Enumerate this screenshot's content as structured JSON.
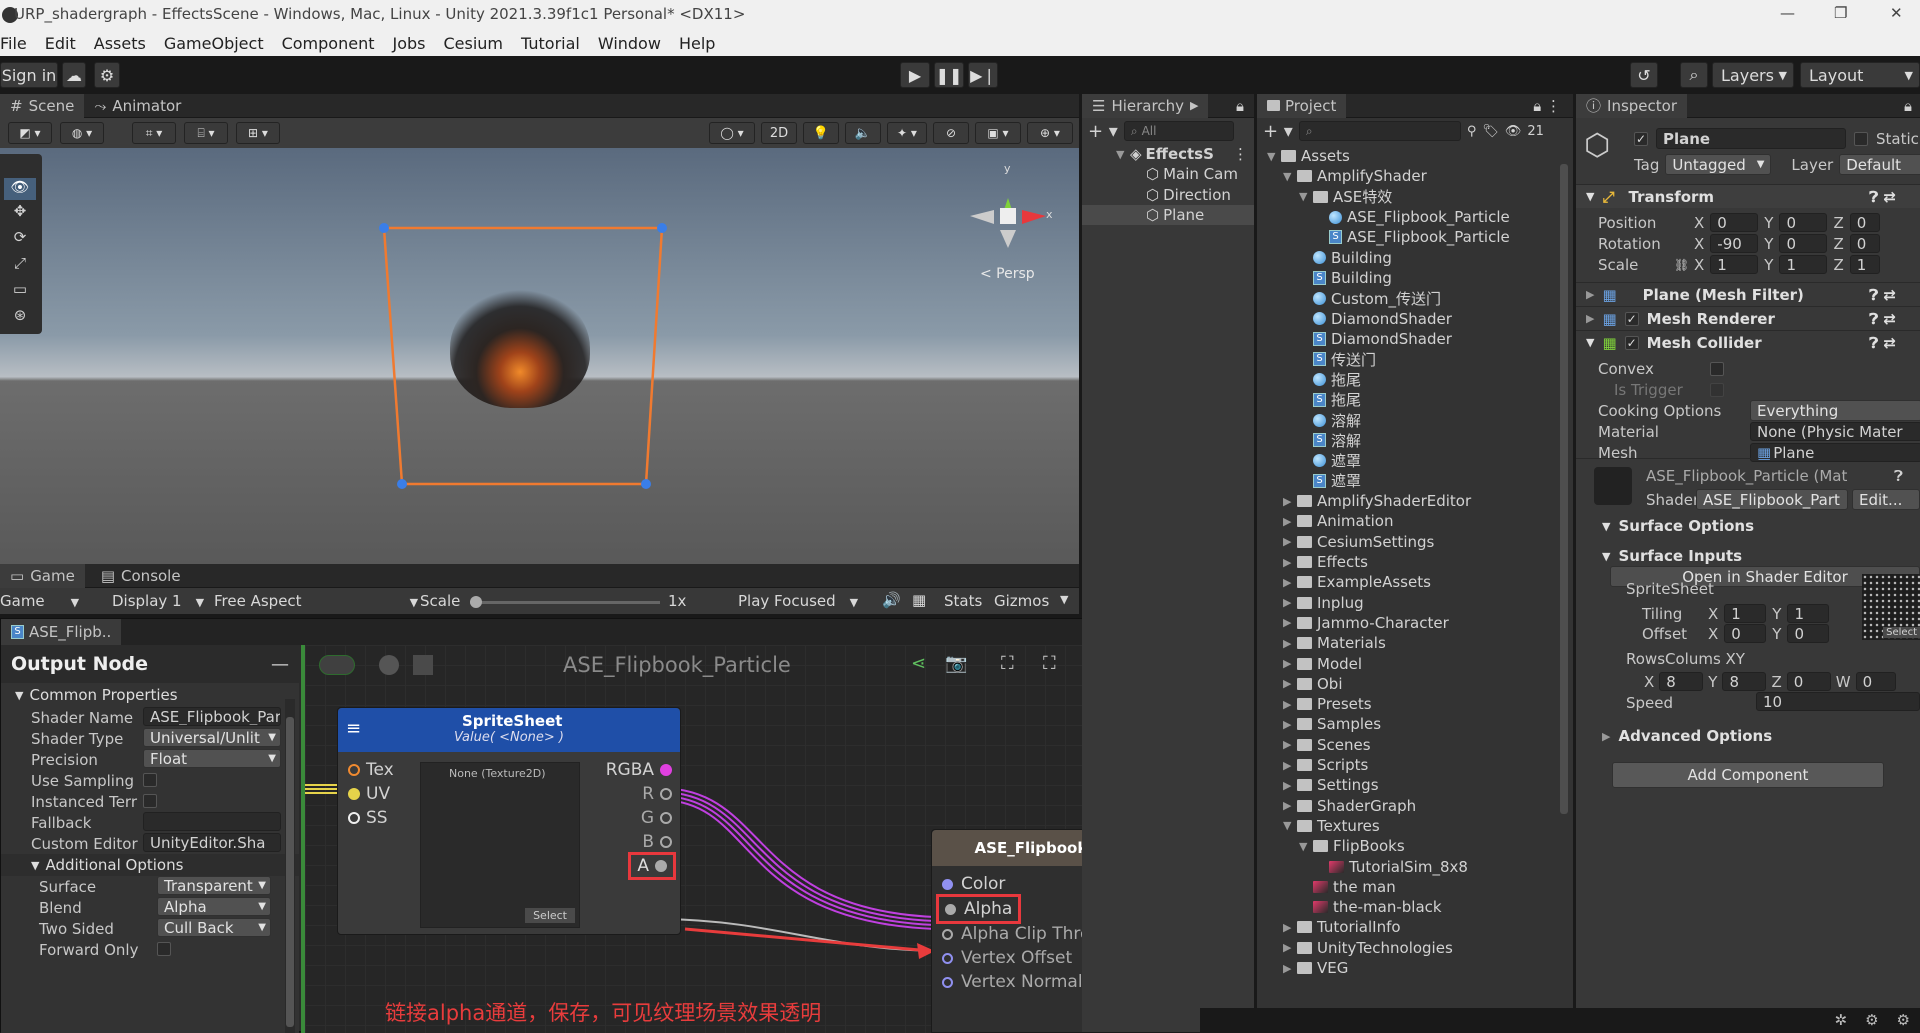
{
  "window": {
    "title": "URP_shadergraph - EffectsScene - Windows, Mac, Linux - Unity 2021.3.39f1c1 Personal* <DX11>",
    "controls": [
      "—",
      "❐",
      "✕"
    ]
  },
  "menu": [
    "File",
    "Edit",
    "Assets",
    "GameObject",
    "Component",
    "Jobs",
    "Cesium",
    "Tutorial",
    "Window",
    "Help"
  ],
  "toolbar": {
    "sign_in": "Sign in",
    "layers": "Layers",
    "layout": "Layout"
  },
  "scene": {
    "tabs": [
      "Scene",
      "Animator"
    ],
    "twod": "2D",
    "persp": "< Persp",
    "gizmo_y": "y",
    "gizmo_x": "x"
  },
  "game": {
    "tabs": [
      "Game",
      "Console"
    ],
    "mode": "Game",
    "display": "Display 1",
    "aspect": "Free Aspect",
    "scale_label": "Scale",
    "scale_value": "1x",
    "play_focused": "Play Focused",
    "stats": "Stats",
    "gizmos": "Gizmos"
  },
  "hierarchy": {
    "tab": "Hierarchy",
    "search_placeholder": "All",
    "scene": "EffectsS",
    "items": [
      "Main Cam",
      "Direction",
      "Plane"
    ]
  },
  "project": {
    "tab": "Project",
    "count": "21",
    "items": [
      {
        "label": "Assets",
        "depth": 0,
        "kind": "folder",
        "open": true
      },
      {
        "label": "AmplifyShader",
        "depth": 1,
        "kind": "folder",
        "open": true
      },
      {
        "label": "ASE特效",
        "depth": 2,
        "kind": "folder",
        "open": true
      },
      {
        "label": "ASE_Flipbook_Particle",
        "depth": 3,
        "kind": "mat"
      },
      {
        "label": "ASE_Flipbook_Particle",
        "depth": 3,
        "kind": "shader"
      },
      {
        "label": "Building",
        "depth": 2,
        "kind": "mat"
      },
      {
        "label": "Building",
        "depth": 2,
        "kind": "shader"
      },
      {
        "label": "Custom_传送门",
        "depth": 2,
        "kind": "mat"
      },
      {
        "label": "DiamondShader",
        "depth": 2,
        "kind": "mat"
      },
      {
        "label": "DiamondShader",
        "depth": 2,
        "kind": "shader"
      },
      {
        "label": "传送门",
        "depth": 2,
        "kind": "shader"
      },
      {
        "label": "拖尾",
        "depth": 2,
        "kind": "mat"
      },
      {
        "label": "拖尾",
        "depth": 2,
        "kind": "shader"
      },
      {
        "label": "溶解",
        "depth": 2,
        "kind": "mat"
      },
      {
        "label": "溶解",
        "depth": 2,
        "kind": "shader"
      },
      {
        "label": "遮罩",
        "depth": 2,
        "kind": "mat"
      },
      {
        "label": "遮罩",
        "depth": 2,
        "kind": "shader"
      },
      {
        "label": "AmplifyShaderEditor",
        "depth": 1,
        "kind": "folder"
      },
      {
        "label": "Animation",
        "depth": 1,
        "kind": "folder"
      },
      {
        "label": "CesiumSettings",
        "depth": 1,
        "kind": "folder"
      },
      {
        "label": "Effects",
        "depth": 1,
        "kind": "folder"
      },
      {
        "label": "ExampleAssets",
        "depth": 1,
        "kind": "folder"
      },
      {
        "label": "Inplug",
        "depth": 1,
        "kind": "folder"
      },
      {
        "label": "Jammo-Character",
        "depth": 1,
        "kind": "folder"
      },
      {
        "label": "Materials",
        "depth": 1,
        "kind": "folder"
      },
      {
        "label": "Model",
        "depth": 1,
        "kind": "folder"
      },
      {
        "label": "Obi",
        "depth": 1,
        "kind": "folder"
      },
      {
        "label": "Presets",
        "depth": 1,
        "kind": "folder"
      },
      {
        "label": "Samples",
        "depth": 1,
        "kind": "folder"
      },
      {
        "label": "Scenes",
        "depth": 1,
        "kind": "folder"
      },
      {
        "label": "Scripts",
        "depth": 1,
        "kind": "folder"
      },
      {
        "label": "Settings",
        "depth": 1,
        "kind": "folder"
      },
      {
        "label": "ShaderGraph",
        "depth": 1,
        "kind": "folder"
      },
      {
        "label": "Textures",
        "depth": 1,
        "kind": "folder",
        "open": true
      },
      {
        "label": "FlipBooks",
        "depth": 2,
        "kind": "folder",
        "open": true
      },
      {
        "label": "TutorialSim_8x8",
        "depth": 3,
        "kind": "tex"
      },
      {
        "label": "the man",
        "depth": 2,
        "kind": "tex"
      },
      {
        "label": "the-man-black",
        "depth": 2,
        "kind": "tex"
      },
      {
        "label": "TutorialInfo",
        "depth": 1,
        "kind": "folder"
      },
      {
        "label": "UnityTechnologies",
        "depth": 1,
        "kind": "folder"
      },
      {
        "label": "VEG",
        "depth": 1,
        "kind": "folder"
      }
    ]
  },
  "inspector": {
    "tab": "Inspector",
    "name": "Plane",
    "static": "Static",
    "tag_label": "Tag",
    "tag": "Untagged",
    "layer_label": "Layer",
    "layer": "Default",
    "transform": {
      "title": "Transform",
      "rows": [
        {
          "label": "Position",
          "x": "0",
          "y": "0",
          "z": "0"
        },
        {
          "label": "Rotation",
          "x": "-90",
          "y": "0",
          "z": "0"
        },
        {
          "label": "Scale",
          "x": "1",
          "y": "1",
          "z": "1"
        }
      ]
    },
    "mesh_filter": "Plane (Mesh Filter)",
    "mesh_renderer": "Mesh Renderer",
    "mesh_collider": "Mesh Collider",
    "collider": {
      "convex": "Convex",
      "is_trigger": "Is Trigger",
      "cooking_label": "Cooking Options",
      "cooking": "Everything",
      "material_label": "Material",
      "material": "None (Physic Mater",
      "mesh_label": "Mesh",
      "mesh": "Plane"
    },
    "material": {
      "name": "ASE_Flipbook_Particle (Mat",
      "shader_label": "Shader",
      "shader": "ASE_Flipbook_Part",
      "edit": "Edit..."
    },
    "surface_options": "Surface Options",
    "surface_inputs": "Surface Inputs",
    "open_editor": "Open in Shader Editor",
    "spritesheet": "SpriteSheet",
    "select": "Select",
    "tiling": {
      "label": "Tiling",
      "x": "1",
      "y": "1"
    },
    "offset": {
      "label": "Offset",
      "x": "0",
      "y": "0"
    },
    "rows_cols": {
      "label": "RowsColums XY",
      "x": "8",
      "y": "8",
      "z": "0",
      "w": "0"
    },
    "speed": {
      "label": "Speed",
      "value": "10"
    },
    "advanced": "Advanced Options",
    "add_component": "Add Component"
  },
  "shader_editor": {
    "tab": "ASE_Flipb..",
    "title": "ASE_Flipbook_Particle",
    "output_node": "Output Node",
    "common": "Common Properties",
    "props": [
      {
        "label": "Shader Name",
        "value": "ASE_Flipbook_Par",
        "type": "field"
      },
      {
        "label": "Shader Type",
        "value": "Universal/Unlit",
        "type": "dd"
      },
      {
        "label": "Precision",
        "value": "Float",
        "type": "dd"
      },
      {
        "label": "Use Sampling",
        "value": "",
        "type": "check"
      },
      {
        "label": "Instanced Terr",
        "value": "",
        "type": "check"
      },
      {
        "label": "Fallback",
        "value": "",
        "type": "field"
      },
      {
        "label": "Custom Editor",
        "value": "UnityEditor.Sha",
        "type": "field"
      }
    ],
    "additional": "Additional Options",
    "add_props": [
      {
        "label": "Surface",
        "value": "Transparent"
      },
      {
        "label": "Blend",
        "value": "Alpha"
      },
      {
        "label": "Two Sided",
        "value": "Cull Back"
      },
      {
        "label": "Forward Only",
        "value": ""
      }
    ],
    "sprite_node": {
      "title": "SpriteSheet",
      "subtitle": "Value( <None> )",
      "inputs": [
        "Tex",
        "UV",
        "SS"
      ],
      "outputs": [
        "RGBA",
        "R",
        "G",
        "B",
        "A"
      ],
      "texture": "None (Texture2D)",
      "select": "Select"
    },
    "output": {
      "title": "ASE_Flipbook_Particle",
      "ports": [
        "Color",
        "Alpha",
        "Alpha Clip Threshold",
        "Vertex Offset",
        "Vertex Normal"
      ]
    },
    "annotation": "链接alpha通道，保存，可见纹理场景效果透明",
    "ghost_uv": "UV",
    "ghost_u": "U"
  },
  "colors": {
    "accent_red": "#e8383d",
    "annotation": "#e83c3c",
    "selection_orange": "#f07a30",
    "node_header_blue": "#1f4fa8"
  }
}
